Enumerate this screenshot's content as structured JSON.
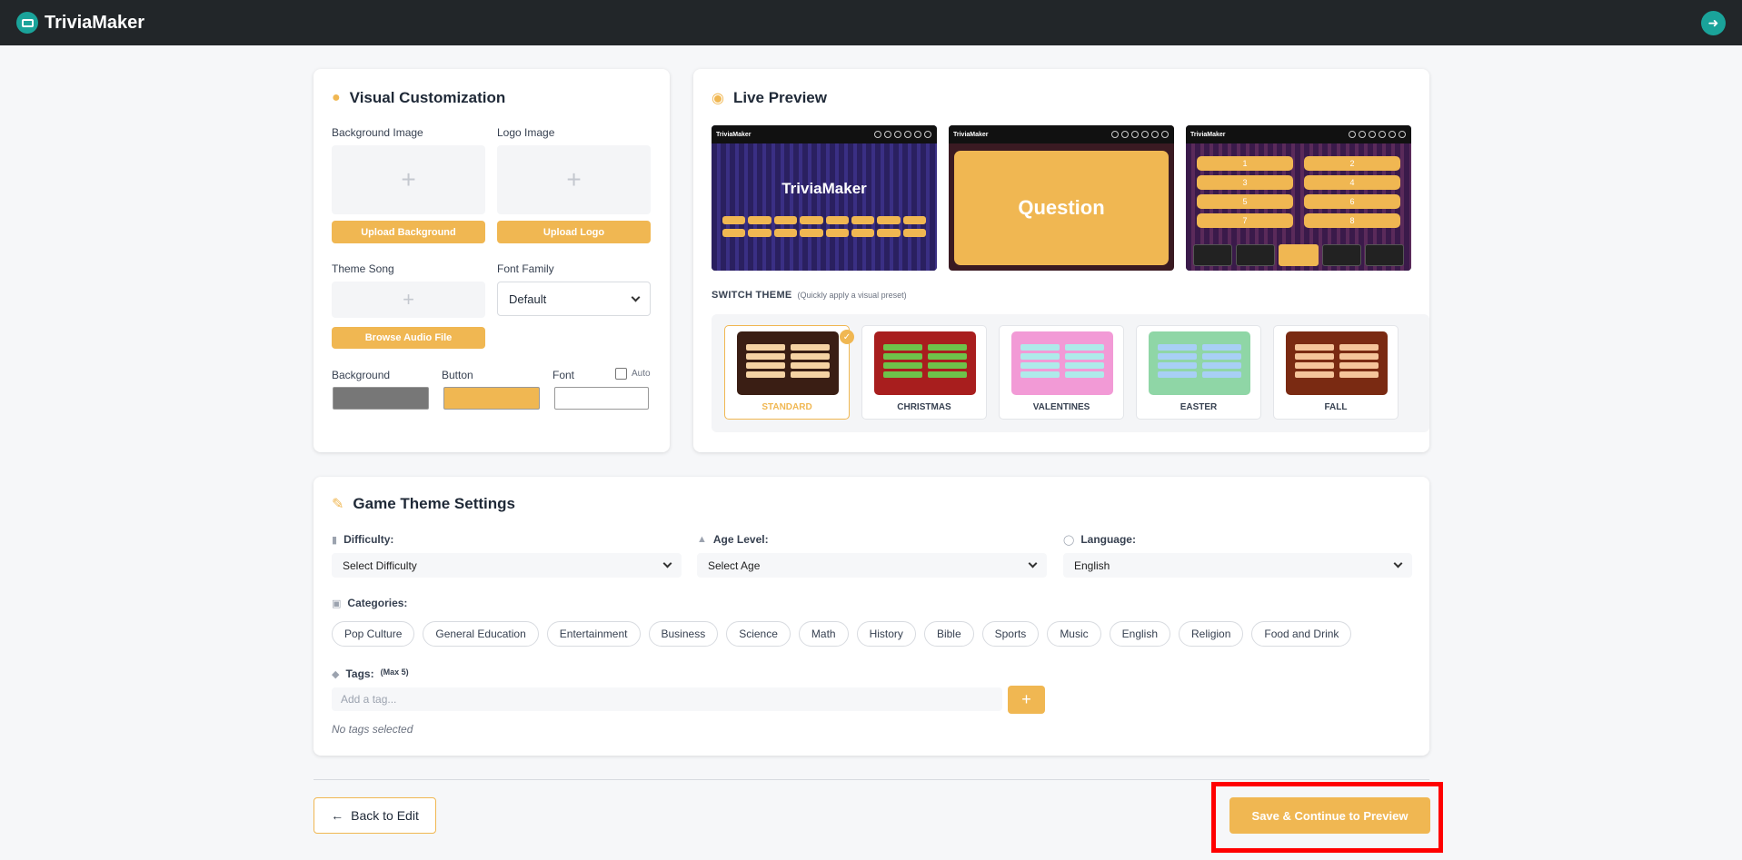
{
  "app": {
    "name": "TriviaMaker"
  },
  "visual": {
    "title": "Visual Customization",
    "bg_image_label": "Background Image",
    "logo_image_label": "Logo Image",
    "plus": "+",
    "upload_bg": "Upload Background",
    "upload_logo": "Upload Logo",
    "theme_song_label": "Theme Song",
    "browse_audio": "Browse Audio File",
    "font_family_label": "Font Family",
    "font_family_value": "Default",
    "color_bg_label": "Background",
    "color_button_label": "Button",
    "color_font_label": "Font",
    "auto_label": "Auto",
    "colors": {
      "background": "#777777",
      "button": "#f0b752",
      "font": "#ffffff"
    }
  },
  "preview": {
    "title": "Live Preview",
    "mini_logo": "TriviaMaker",
    "big_logo": "TriviaMaker",
    "question": "Question",
    "answers": [
      "1",
      "2",
      "3",
      "4",
      "5",
      "6",
      "7",
      "8"
    ],
    "switch_theme_label": "SWITCH THEME",
    "switch_theme_hint": "(Quickly apply a visual preset)",
    "themes": [
      {
        "name": "STANDARD",
        "active": true
      },
      {
        "name": "CHRISTMAS",
        "active": false
      },
      {
        "name": "VALENTINES",
        "active": false
      },
      {
        "name": "EASTER",
        "active": false
      },
      {
        "name": "FALL",
        "active": false
      }
    ]
  },
  "game": {
    "title": "Game Theme Settings",
    "difficulty_label": "Difficulty:",
    "difficulty_value": "Select Difficulty",
    "age_label": "Age Level:",
    "age_value": "Select Age",
    "language_label": "Language:",
    "language_value": "English",
    "categories_label": "Categories:",
    "categories": [
      "Pop Culture",
      "General Education",
      "Entertainment",
      "Business",
      "Science",
      "Math",
      "History",
      "Bible",
      "Sports",
      "Music",
      "English",
      "Religion",
      "Food and Drink"
    ],
    "tags_label": "Tags:",
    "tags_max": "(Max 5)",
    "tag_placeholder": "Add a tag...",
    "add_tag": "+",
    "no_tags": "No tags selected"
  },
  "footer": {
    "back": "Back to Edit",
    "save": "Save & Continue to Preview"
  }
}
